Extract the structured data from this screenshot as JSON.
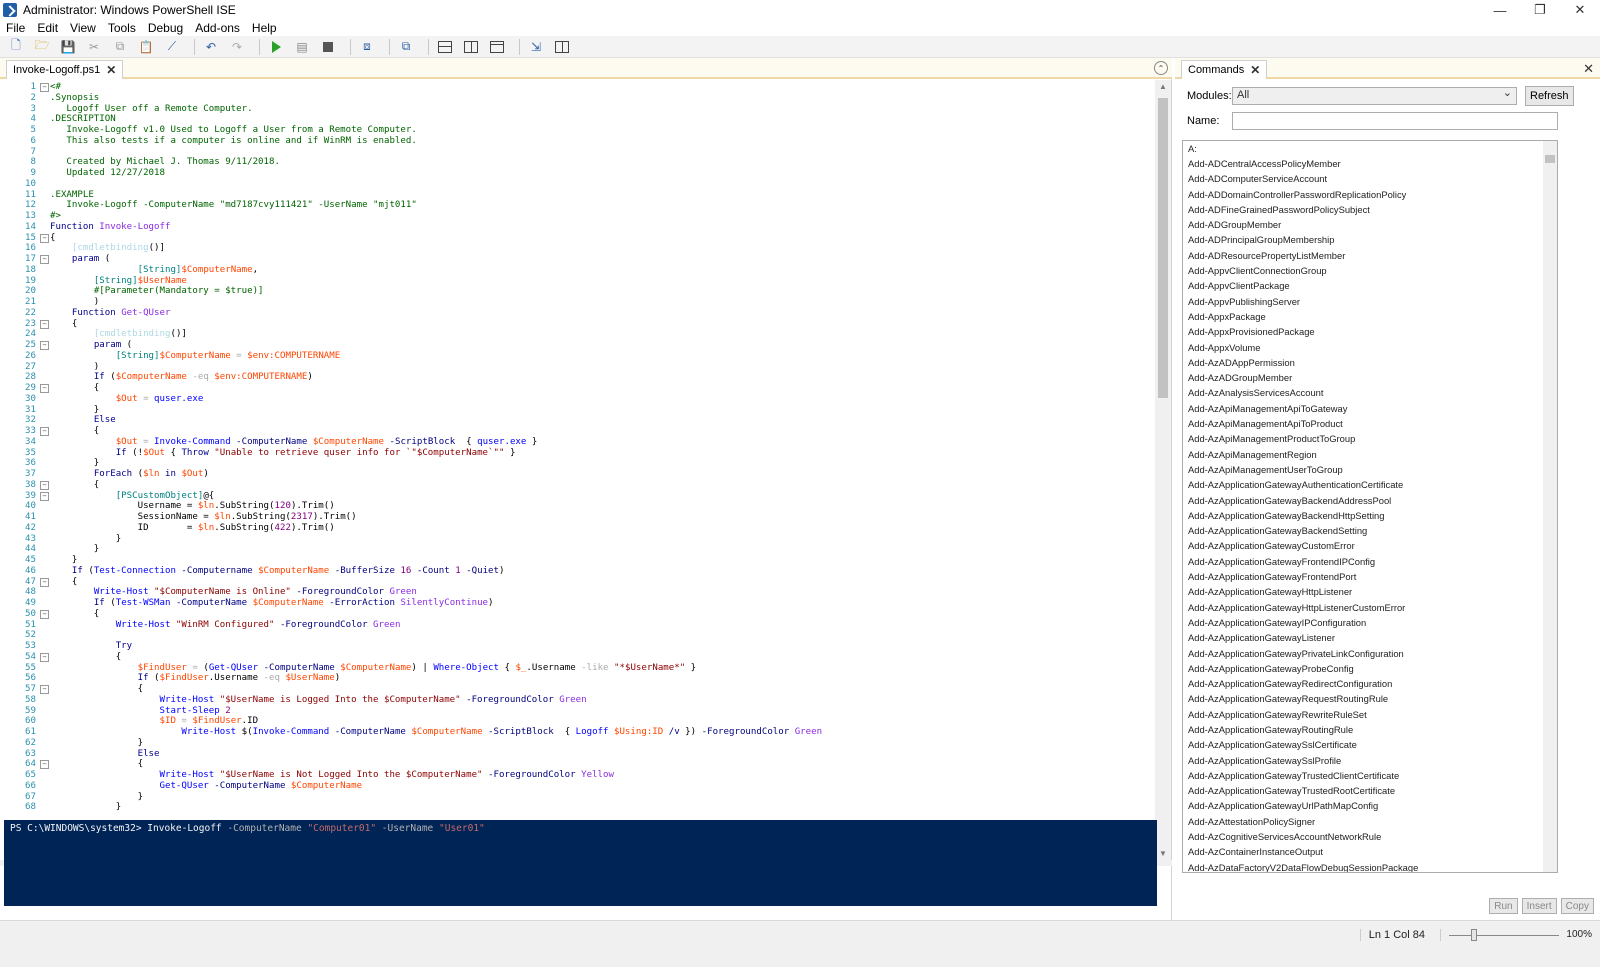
{
  "window": {
    "title": "Administrator: Windows PowerShell ISE",
    "minimize": "—",
    "restore": "❐",
    "close": "✕"
  },
  "menu": [
    "File",
    "Edit",
    "View",
    "Tools",
    "Debug",
    "Add-ons",
    "Help"
  ],
  "toolbar": {
    "icons": [
      "new-file-icon",
      "open-icon",
      "save-icon",
      "cut-icon",
      "copy-icon",
      "paste-icon",
      "clear-console-icon",
      "undo-icon",
      "redo-icon",
      "run-script-icon",
      "run-selection-icon",
      "stop-icon",
      "new-remote-tab-icon",
      "start-powershell-icon",
      "layout-top-icon",
      "layout-right-icon",
      "layout-max-icon",
      "show-script-icon",
      "show-commands-icon"
    ]
  },
  "editor": {
    "tab_label": "Invoke-Logoff.ps1",
    "close_glyph": "✕",
    "collapse_glyph": "⌃"
  },
  "console": {
    "prompt": "PS C:\\WINDOWS\\system32> ",
    "command": "Invoke-Logoff",
    "param1": " -ComputerName ",
    "value1": "\"Computer01\"",
    "param2": " -UserName ",
    "value2": "\"User01\""
  },
  "commands_pane": {
    "tab_label": "Commands",
    "close_glyph": "✕",
    "modules_label": "Modules:",
    "modules_value": "All",
    "refresh_label": "Refresh",
    "name_label": "Name:",
    "name_value": "",
    "run_label": "Run",
    "insert_label": "Insert",
    "copy_label": "Copy",
    "items": [
      "A:",
      "Add-ADCentralAccessPolicyMember",
      "Add-ADComputerServiceAccount",
      "Add-ADDomainControllerPasswordReplicationPolicy",
      "Add-ADFineGrainedPasswordPolicySubject",
      "Add-ADGroupMember",
      "Add-ADPrincipalGroupMembership",
      "Add-ADResourcePropertyListMember",
      "Add-AppvClientConnectionGroup",
      "Add-AppvClientPackage",
      "Add-AppvPublishingServer",
      "Add-AppxPackage",
      "Add-AppxProvisionedPackage",
      "Add-AppxVolume",
      "Add-AzADAppPermission",
      "Add-AzADGroupMember",
      "Add-AzAnalysisServicesAccount",
      "Add-AzApiManagementApiToGateway",
      "Add-AzApiManagementApiToProduct",
      "Add-AzApiManagementProductToGroup",
      "Add-AzApiManagementRegion",
      "Add-AzApiManagementUserToGroup",
      "Add-AzApplicationGatewayAuthenticationCertificate",
      "Add-AzApplicationGatewayBackendAddressPool",
      "Add-AzApplicationGatewayBackendHttpSetting",
      "Add-AzApplicationGatewayBackendSetting",
      "Add-AzApplicationGatewayCustomError",
      "Add-AzApplicationGatewayFrontendIPConfig",
      "Add-AzApplicationGatewayFrontendPort",
      "Add-AzApplicationGatewayHttpListener",
      "Add-AzApplicationGatewayHttpListenerCustomError",
      "Add-AzApplicationGatewayIPConfiguration",
      "Add-AzApplicationGatewayListener",
      "Add-AzApplicationGatewayPrivateLinkConfiguration",
      "Add-AzApplicationGatewayProbeConfig",
      "Add-AzApplicationGatewayRedirectConfiguration",
      "Add-AzApplicationGatewayRequestRoutingRule",
      "Add-AzApplicationGatewayRewriteRuleSet",
      "Add-AzApplicationGatewayRoutingRule",
      "Add-AzApplicationGatewaySslCertificate",
      "Add-AzApplicationGatewaySslProfile",
      "Add-AzApplicationGatewayTrustedClientCertificate",
      "Add-AzApplicationGatewayTrustedRootCertificate",
      "Add-AzApplicationGatewayUrlPathMapConfig",
      "Add-AzAttestationPolicySigner",
      "Add-AzCognitiveServicesAccountNetworkRule",
      "Add-AzContainerInstanceOutput",
      "Add-AzDataFactoryV2DataFlowDebugSessionPackage"
    ]
  },
  "status": {
    "position": "Ln 1  Col 84",
    "zoom": "100%"
  },
  "code_lines": [
    [
      [
        "c-cm",
        "<#"
      ]
    ],
    [
      [
        "c-cm",
        ".Synopsis"
      ]
    ],
    [
      [
        "c-cm",
        "   Logoff User off a Remote Computer."
      ]
    ],
    [
      [
        "c-cm",
        ".DESCRIPTION"
      ]
    ],
    [
      [
        "c-cm",
        "   Invoke-Logoff v1.0 Used to Logoff a User from a Remote Computer."
      ]
    ],
    [
      [
        "c-cm",
        "   This also tests if a computer is online and if WinRM is enabled."
      ]
    ],
    [
      [
        "c-cm",
        ""
      ]
    ],
    [
      [
        "c-cm",
        "   Created by Michael J. Thomas 9/11/2018."
      ]
    ],
    [
      [
        "c-cm",
        "   Updated 12/27/2018"
      ]
    ],
    [
      [
        "c-cm",
        ""
      ]
    ],
    [
      [
        "c-cm",
        ".EXAMPLE"
      ]
    ],
    [
      [
        "c-cm",
        "   Invoke-Logoff -ComputerName \"md7187cvy111421\" -UserName \"mjt011\""
      ]
    ],
    [
      [
        "c-cm",
        "#>"
      ]
    ],
    [
      [
        "c-kw",
        "Function "
      ],
      [
        "c-fn",
        "Invoke-Logoff"
      ]
    ],
    [
      [
        "",
        "{"
      ]
    ],
    [
      [
        "",
        "    "
      ],
      [
        "c-attr",
        "[cmdletbinding"
      ],
      [
        "",
        "()]"
      ]
    ],
    [
      [
        "",
        "    "
      ],
      [
        "c-kw",
        "param"
      ],
      [
        "",
        " ("
      ]
    ],
    [
      [
        "",
        "                "
      ],
      [
        "c-type",
        "[String]"
      ],
      [
        "c-var",
        "$ComputerName"
      ],
      [
        "",
        ","
      ]
    ],
    [
      [
        "",
        "        "
      ],
      [
        "c-type",
        "[String]"
      ],
      [
        "c-var",
        "$UserName"
      ]
    ],
    [
      [
        "",
        "        "
      ],
      [
        "c-cm",
        "#[Parameter(Mandatory = $true)]"
      ]
    ],
    [
      [
        "",
        "        )"
      ]
    ],
    [
      [
        "",
        "    "
      ],
      [
        "c-kw",
        "Function "
      ],
      [
        "c-fn",
        "Get-QUser"
      ]
    ],
    [
      [
        "",
        "    {"
      ]
    ],
    [
      [
        "",
        "        "
      ],
      [
        "c-attr",
        "[cmdletbinding"
      ],
      [
        "",
        "()]"
      ]
    ],
    [
      [
        "",
        "        "
      ],
      [
        "c-kw",
        "param"
      ],
      [
        "",
        " ("
      ]
    ],
    [
      [
        "",
        "            "
      ],
      [
        "c-type",
        "[String]"
      ],
      [
        "c-var",
        "$ComputerName"
      ],
      [
        "c-op",
        " = "
      ],
      [
        "c-var",
        "$env:COMPUTERNAME"
      ]
    ],
    [
      [
        "",
        "        )"
      ]
    ],
    [
      [
        "",
        "        "
      ],
      [
        "c-kw",
        "If"
      ],
      [
        "",
        " ("
      ],
      [
        "c-var",
        "$ComputerName"
      ],
      [
        "c-op",
        " -eq "
      ],
      [
        "c-var",
        "$env:COMPUTERNAME"
      ],
      [
        "",
        ")"
      ]
    ],
    [
      [
        "",
        "        {"
      ]
    ],
    [
      [
        "",
        "            "
      ],
      [
        "c-var",
        "$Out"
      ],
      [
        "c-op",
        " = "
      ],
      [
        "c-cmd",
        "quser.exe"
      ]
    ],
    [
      [
        "",
        "        }"
      ]
    ],
    [
      [
        "",
        "        "
      ],
      [
        "c-kw",
        "Else"
      ]
    ],
    [
      [
        "",
        "        {"
      ]
    ],
    [
      [
        "",
        "            "
      ],
      [
        "c-var",
        "$Out"
      ],
      [
        "c-op",
        " = "
      ],
      [
        "c-cmd",
        "Invoke-Command"
      ],
      [
        "c-par",
        " -ComputerName "
      ],
      [
        "c-var",
        "$ComputerName"
      ],
      [
        "c-par",
        " -ScriptBlock "
      ],
      [
        "",
        " { "
      ],
      [
        "c-cmd",
        "quser.exe"
      ],
      [
        "",
        " }"
      ]
    ],
    [
      [
        "",
        "            "
      ],
      [
        "c-kw",
        "If"
      ],
      [
        "",
        " (!"
      ],
      [
        "c-var",
        "$Out"
      ],
      [
        "",
        " { "
      ],
      [
        "c-kw",
        "Throw"
      ],
      [
        "c-str",
        " \"Unable to retrieve quser info for `\"$ComputerName`\"\""
      ],
      [
        "",
        " }"
      ]
    ],
    [
      [
        "",
        "        }"
      ]
    ],
    [
      [
        "",
        "        "
      ],
      [
        "c-kw",
        "ForEach"
      ],
      [
        "",
        " ("
      ],
      [
        "c-var",
        "$ln"
      ],
      [
        "c-kw",
        " in "
      ],
      [
        "c-var",
        "$Out"
      ],
      [
        "",
        ")"
      ]
    ],
    [
      [
        "",
        "        {"
      ]
    ],
    [
      [
        "",
        "            "
      ],
      [
        "c-type",
        "[PSCustomObject]"
      ],
      [
        "",
        "@{"
      ]
    ],
    [
      [
        "",
        "                Username = "
      ],
      [
        "c-var",
        "$ln"
      ],
      [
        "",
        ".SubString("
      ],
      [
        "c-num",
        "1"
      ],
      [
        ", "
      ],
      [
        "c-num",
        "20"
      ],
      [
        "",
        ").Trim()"
      ]
    ],
    [
      [
        "",
        "                SessionName = "
      ],
      [
        "c-var",
        "$ln"
      ],
      [
        "",
        ".SubString("
      ],
      [
        "c-num",
        "23"
      ],
      [
        ", "
      ],
      [
        "c-num",
        "17"
      ],
      [
        "",
        ").Trim()"
      ]
    ],
    [
      [
        "",
        "                ID       = "
      ],
      [
        "c-var",
        "$ln"
      ],
      [
        "",
        ".SubString("
      ],
      [
        "c-num",
        "42"
      ],
      [
        ", "
      ],
      [
        "c-num",
        "2"
      ],
      [
        "",
        ").Trim()"
      ]
    ],
    [
      [
        "",
        "            }"
      ]
    ],
    [
      [
        "",
        "        }"
      ]
    ],
    [
      [
        "",
        "    }"
      ]
    ],
    [
      [
        "",
        "    "
      ],
      [
        "c-kw",
        "If"
      ],
      [
        "",
        " ("
      ],
      [
        "c-cmd",
        "Test-Connection"
      ],
      [
        "c-par",
        " -Computername "
      ],
      [
        "c-var",
        "$ComputerName"
      ],
      [
        "c-par",
        " -BufferSize "
      ],
      [
        "c-num",
        "16"
      ],
      [
        "c-par",
        " -Count "
      ],
      [
        "c-num",
        "1"
      ],
      [
        "c-par",
        " -Quiet"
      ],
      [
        "",
        ")"
      ]
    ],
    [
      [
        "",
        "    {"
      ]
    ],
    [
      [
        "",
        "        "
      ],
      [
        "c-cmd",
        "Write-Host"
      ],
      [
        "c-str",
        " \"$ComputerName is Online\""
      ],
      [
        "c-par",
        " -ForegroundColor "
      ],
      [
        "c-fn",
        "Green"
      ]
    ],
    [
      [
        "",
        "        "
      ],
      [
        "c-kw",
        "If"
      ],
      [
        "",
        " ("
      ],
      [
        "c-cmd",
        "Test-WSMan"
      ],
      [
        "c-par",
        " -ComputerName "
      ],
      [
        "c-var",
        "$ComputerName"
      ],
      [
        "c-par",
        " -ErrorAction "
      ],
      [
        "c-fn",
        "SilentlyContinue"
      ],
      [
        "",
        ")"
      ]
    ],
    [
      [
        "",
        "        {"
      ]
    ],
    [
      [
        "",
        "            "
      ],
      [
        "c-cmd",
        "Write-Host"
      ],
      [
        "c-str",
        " \"WinRM Configured\""
      ],
      [
        "c-par",
        " -ForegroundColor "
      ],
      [
        "c-fn",
        "Green"
      ]
    ],
    [
      [
        "",
        ""
      ]
    ],
    [
      [
        "",
        "            "
      ],
      [
        "c-kw",
        "Try"
      ]
    ],
    [
      [
        "",
        "            {"
      ]
    ],
    [
      [
        "",
        "                "
      ],
      [
        "c-var",
        "$FindUser"
      ],
      [
        "c-op",
        " = "
      ],
      [
        "",
        "("
      ],
      [
        "c-cmd",
        "Get-QUser"
      ],
      [
        "c-par",
        " -ComputerName "
      ],
      [
        "c-var",
        "$ComputerName"
      ],
      [
        "",
        ") | "
      ],
      [
        "c-cmd",
        "Where-Object"
      ],
      [
        "",
        " { "
      ],
      [
        "c-var",
        "$_"
      ],
      [
        "",
        ".Username "
      ],
      [
        "c-op",
        "-like "
      ],
      [
        "c-str",
        "\"*$UserName*\""
      ],
      [
        "",
        " }"
      ]
    ],
    [
      [
        "",
        "                "
      ],
      [
        "c-kw",
        "If"
      ],
      [
        "",
        " ("
      ],
      [
        "c-var",
        "$FindUser"
      ],
      [
        "",
        ".Username "
      ],
      [
        "c-op",
        "-eq "
      ],
      [
        "c-var",
        "$UserName"
      ],
      [
        "",
        ")"
      ]
    ],
    [
      [
        "",
        "                {"
      ]
    ],
    [
      [
        "",
        "                    "
      ],
      [
        "c-cmd",
        "Write-Host"
      ],
      [
        "c-str",
        " \"$UserName is Logged Into the $ComputerName\""
      ],
      [
        "c-par",
        " -ForegroundColor "
      ],
      [
        "c-fn",
        "Green"
      ]
    ],
    [
      [
        "",
        "                    "
      ],
      [
        "c-cmd",
        "Start-Sleep"
      ],
      [
        "c-num",
        " 2"
      ]
    ],
    [
      [
        "",
        "                    "
      ],
      [
        "c-var",
        "$ID"
      ],
      [
        "c-op",
        " = "
      ],
      [
        "c-var",
        "$FindUser"
      ],
      [
        "",
        ".ID"
      ]
    ],
    [
      [
        "",
        "                        "
      ],
      [
        "c-cmd",
        "Write-Host"
      ],
      [
        "",
        " $("
      ],
      [
        "c-cmd",
        "Invoke-Command"
      ],
      [
        "c-par",
        " -ComputerName "
      ],
      [
        "c-var",
        "$ComputerName"
      ],
      [
        "c-par",
        " -ScriptBlock "
      ],
      [
        "",
        " { "
      ],
      [
        "c-cmd",
        "Logoff "
      ],
      [
        "c-var",
        "$Using:ID"
      ],
      [
        "c-par",
        " /v"
      ],
      [
        "",
        " })"
      ],
      [
        "c-par",
        " -ForegroundColor "
      ],
      [
        "c-fn",
        "Green"
      ]
    ],
    [
      [
        "",
        "                }"
      ]
    ],
    [
      [
        "",
        "                "
      ],
      [
        "c-kw",
        "Else"
      ]
    ],
    [
      [
        "",
        "                {"
      ]
    ],
    [
      [
        "",
        "                    "
      ],
      [
        "c-cmd",
        "Write-Host"
      ],
      [
        "c-str",
        " \"$UserName is Not Logged Into the $ComputerName\""
      ],
      [
        "c-par",
        " -ForegroundColor "
      ],
      [
        "c-fn",
        "Yellow"
      ]
    ],
    [
      [
        "",
        "                    "
      ],
      [
        "c-cmd",
        "Get-QUser"
      ],
      [
        "c-par",
        " -ComputerName "
      ],
      [
        "c-var",
        "$ComputerName"
      ]
    ],
    [
      [
        "",
        "                }"
      ]
    ],
    [
      [
        "",
        "            }"
      ]
    ]
  ],
  "fold_lines": [
    1,
    15,
    17,
    23,
    25,
    29,
    33,
    38,
    39,
    47,
    50,
    54,
    57,
    64
  ]
}
